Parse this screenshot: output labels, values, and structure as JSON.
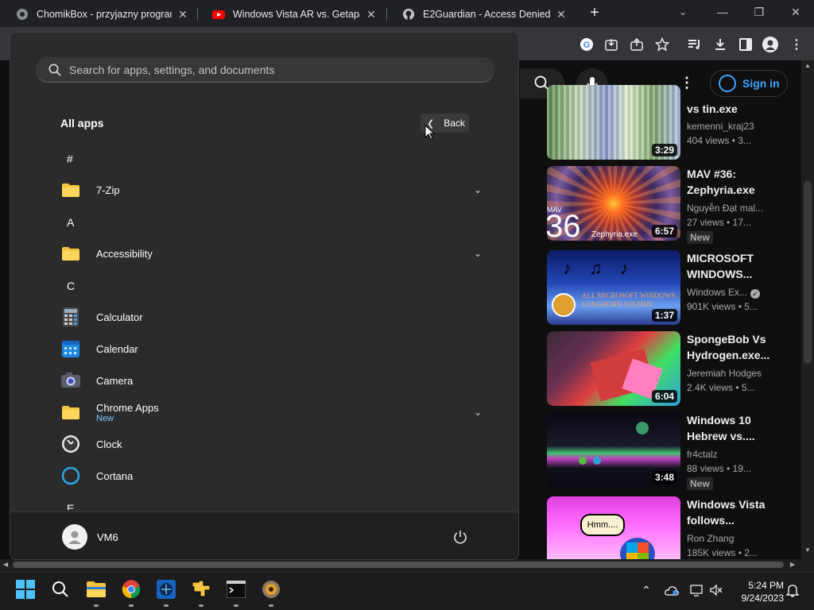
{
  "browser": {
    "tabs": [
      {
        "title": "ChomikBox - przyjazny program",
        "icon": "chomikbox-icon"
      },
      {
        "title": "Windows Vista AR vs. Getaparanc",
        "icon": "youtube-icon"
      },
      {
        "title": "E2Guardian - Access Denied",
        "icon": "github-icon"
      }
    ],
    "new_tab": "+"
  },
  "youtube": {
    "sign_in": "Sign in",
    "videos": [
      {
        "title": "vs tin.exe",
        "channel": "kemenni_kraj23",
        "meta": "404 views • 3...",
        "duration": "3:29",
        "badge": ""
      },
      {
        "title": "MAV #36: Zephyria.exe",
        "channel": "Nguyễn Đạt mal...",
        "meta": "27 views • 17...",
        "duration": "6:57",
        "badge": "New",
        "thumb_text_big": "36",
        "thumb_text_small": "MAV",
        "thumb_caption": "Zephyria.exe"
      },
      {
        "title": "MICROSOFT WINDOWS...",
        "channel": "Windows Ex...",
        "meta": "901K views • 5...",
        "duration": "1:37",
        "badge": "",
        "verified": true,
        "thumb_text": "ALL MICROSOFT WINDOWS LONGHORN SOUNDS"
      },
      {
        "title": "SpongeBob Vs Hydrogen.exe...",
        "channel": "Jeremiah Hodges",
        "meta": "2.4K views • 5...",
        "duration": "6:04",
        "badge": ""
      },
      {
        "title": "Windows 10 Hebrew vs....",
        "channel": "fr4ctalz",
        "meta": "88 views • 19...",
        "duration": "3:48",
        "badge": "New"
      },
      {
        "title": "Windows Vista follows...",
        "channel": "Ron Zhang",
        "meta": "185K views • 2...",
        "duration": "",
        "badge": "",
        "thumb_text": "Hmm...."
      }
    ]
  },
  "start_menu": {
    "search_placeholder": "Search for apps, settings, and documents",
    "all_apps": "All apps",
    "back": "Back",
    "letters": [
      "#",
      "A",
      "C",
      "E"
    ],
    "apps": [
      {
        "name": "7-Zip",
        "icon": "folder-icon",
        "expandable": true
      },
      {
        "name": "Accessibility",
        "icon": "folder-icon",
        "expandable": true
      },
      {
        "name": "Calculator",
        "icon": "calculator-icon",
        "expandable": false
      },
      {
        "name": "Calendar",
        "icon": "calendar-icon",
        "expandable": false
      },
      {
        "name": "Camera",
        "icon": "camera-icon",
        "expandable": false
      },
      {
        "name": "Chrome Apps",
        "sub": "New",
        "icon": "folder-icon",
        "expandable": true
      },
      {
        "name": "Clock",
        "icon": "clock-icon",
        "expandable": false
      },
      {
        "name": "Cortana",
        "icon": "cortana-icon",
        "expandable": false
      }
    ],
    "user": "VM6"
  },
  "taskbar": {
    "time": "5:24 PM",
    "date": "9/24/2023"
  },
  "colors": {
    "accent": "#3ea6ff",
    "start_bg": "#2b2b2b",
    "folder": "#f4c542"
  }
}
